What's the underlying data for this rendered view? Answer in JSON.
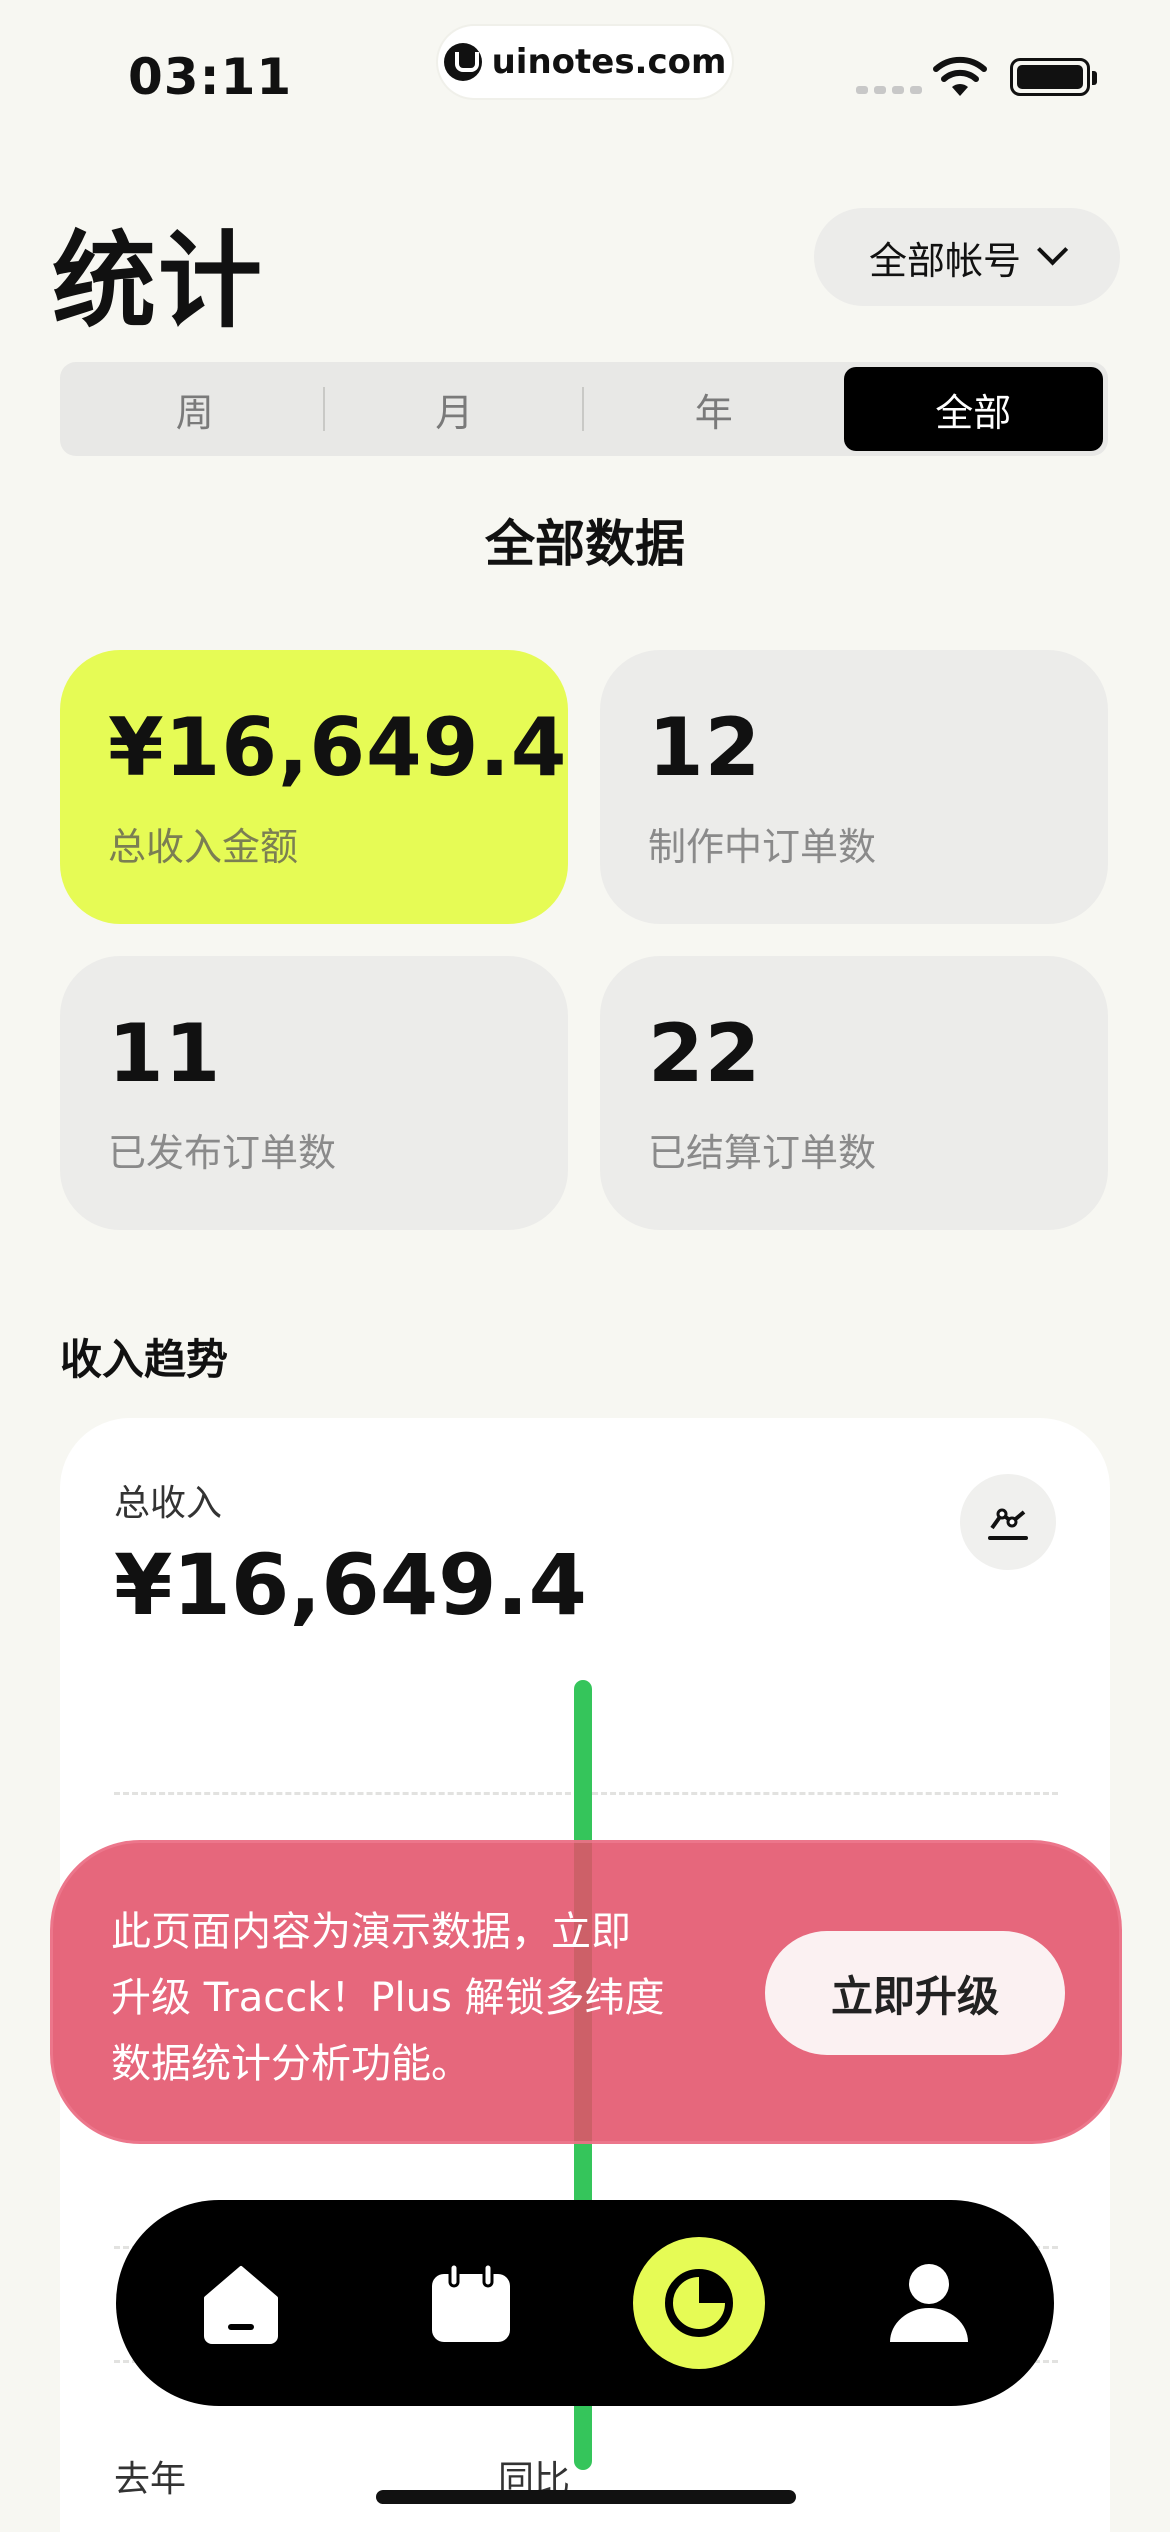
{
  "status_bar": {
    "time": "03:11",
    "url": "uinotes.com"
  },
  "header": {
    "title": "统计",
    "account_selector": "全部帐号"
  },
  "period_tabs": [
    {
      "label": "周",
      "active": false
    },
    {
      "label": "月",
      "active": false
    },
    {
      "label": "年",
      "active": false
    },
    {
      "label": "全部",
      "active": true
    }
  ],
  "section_title": "全部数据",
  "stats": [
    {
      "value": "¥16,649.4",
      "label": "总收入金额",
      "highlight": true
    },
    {
      "value": "12",
      "label": "制作中订单数",
      "highlight": false
    },
    {
      "value": "11",
      "label": "已发布订单数",
      "highlight": false
    },
    {
      "value": "22",
      "label": "已结算订单数",
      "highlight": false
    }
  ],
  "trend": {
    "heading": "收入趋势",
    "label": "总收入",
    "value": "¥16,649.4",
    "footer": {
      "last_year_label": "去年",
      "yoy_label": "同比"
    }
  },
  "banner": {
    "lines": [
      "此页面内容为演示数据，立即",
      "升级 Tracck！Plus 解锁多纬度",
      "数据统计分析功能。"
    ],
    "button": "立即升级"
  },
  "tab_bar": {
    "items": [
      {
        "icon": "home-icon",
        "active": false
      },
      {
        "icon": "calendar-icon",
        "active": false
      },
      {
        "icon": "pie-chart-icon",
        "active": true
      },
      {
        "icon": "profile-icon",
        "active": false
      }
    ],
    "active_color": "#e6fb55"
  },
  "colors": {
    "accent": "#e6fb55",
    "bar_green": "#35c55b",
    "banner_red": "#e2526a"
  }
}
